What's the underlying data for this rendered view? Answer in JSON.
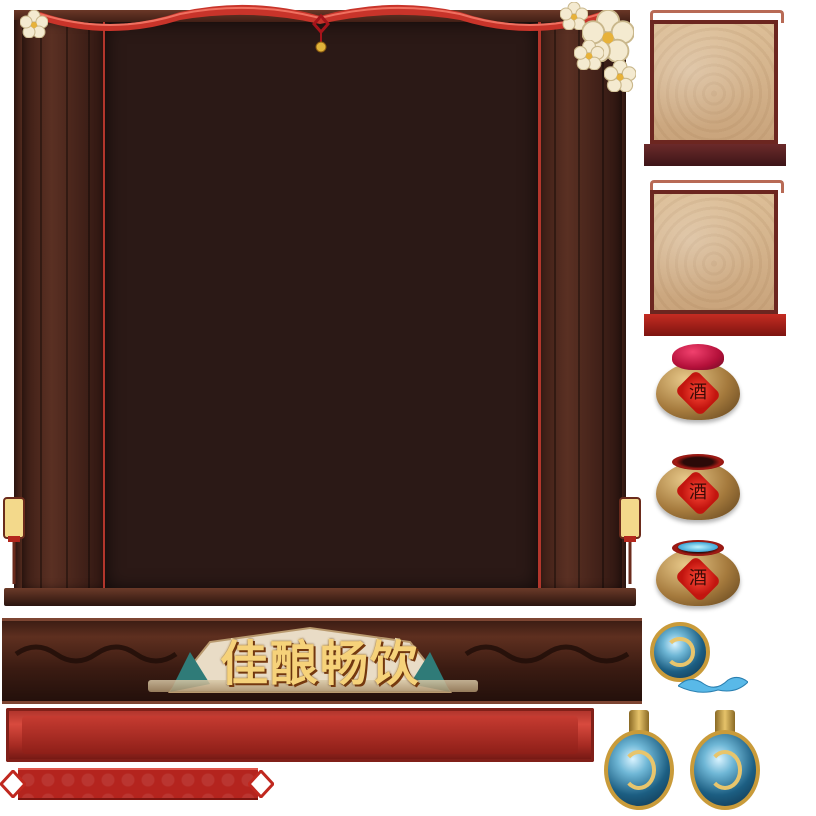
{
  "banner": {
    "title": "佳酿畅饮"
  },
  "items": {
    "jar_label_char": "酒"
  },
  "colors": {
    "stage_panel": "#2b1916",
    "curtain_edge": "#b3362c",
    "banner_title": "#f6d27a",
    "scroll_red": "#c63b31",
    "tab_red": "#b4241e",
    "paper": "#d8b68d",
    "frame_base_dark": "#3d1518",
    "frame_base_red": "#c52c22"
  },
  "icons": [
    "ribbon-icon",
    "knot-icon",
    "lantern-icon",
    "plum-blossom-icon",
    "fan-icon",
    "wine-jar-icon",
    "gourd-flask-icon"
  ]
}
